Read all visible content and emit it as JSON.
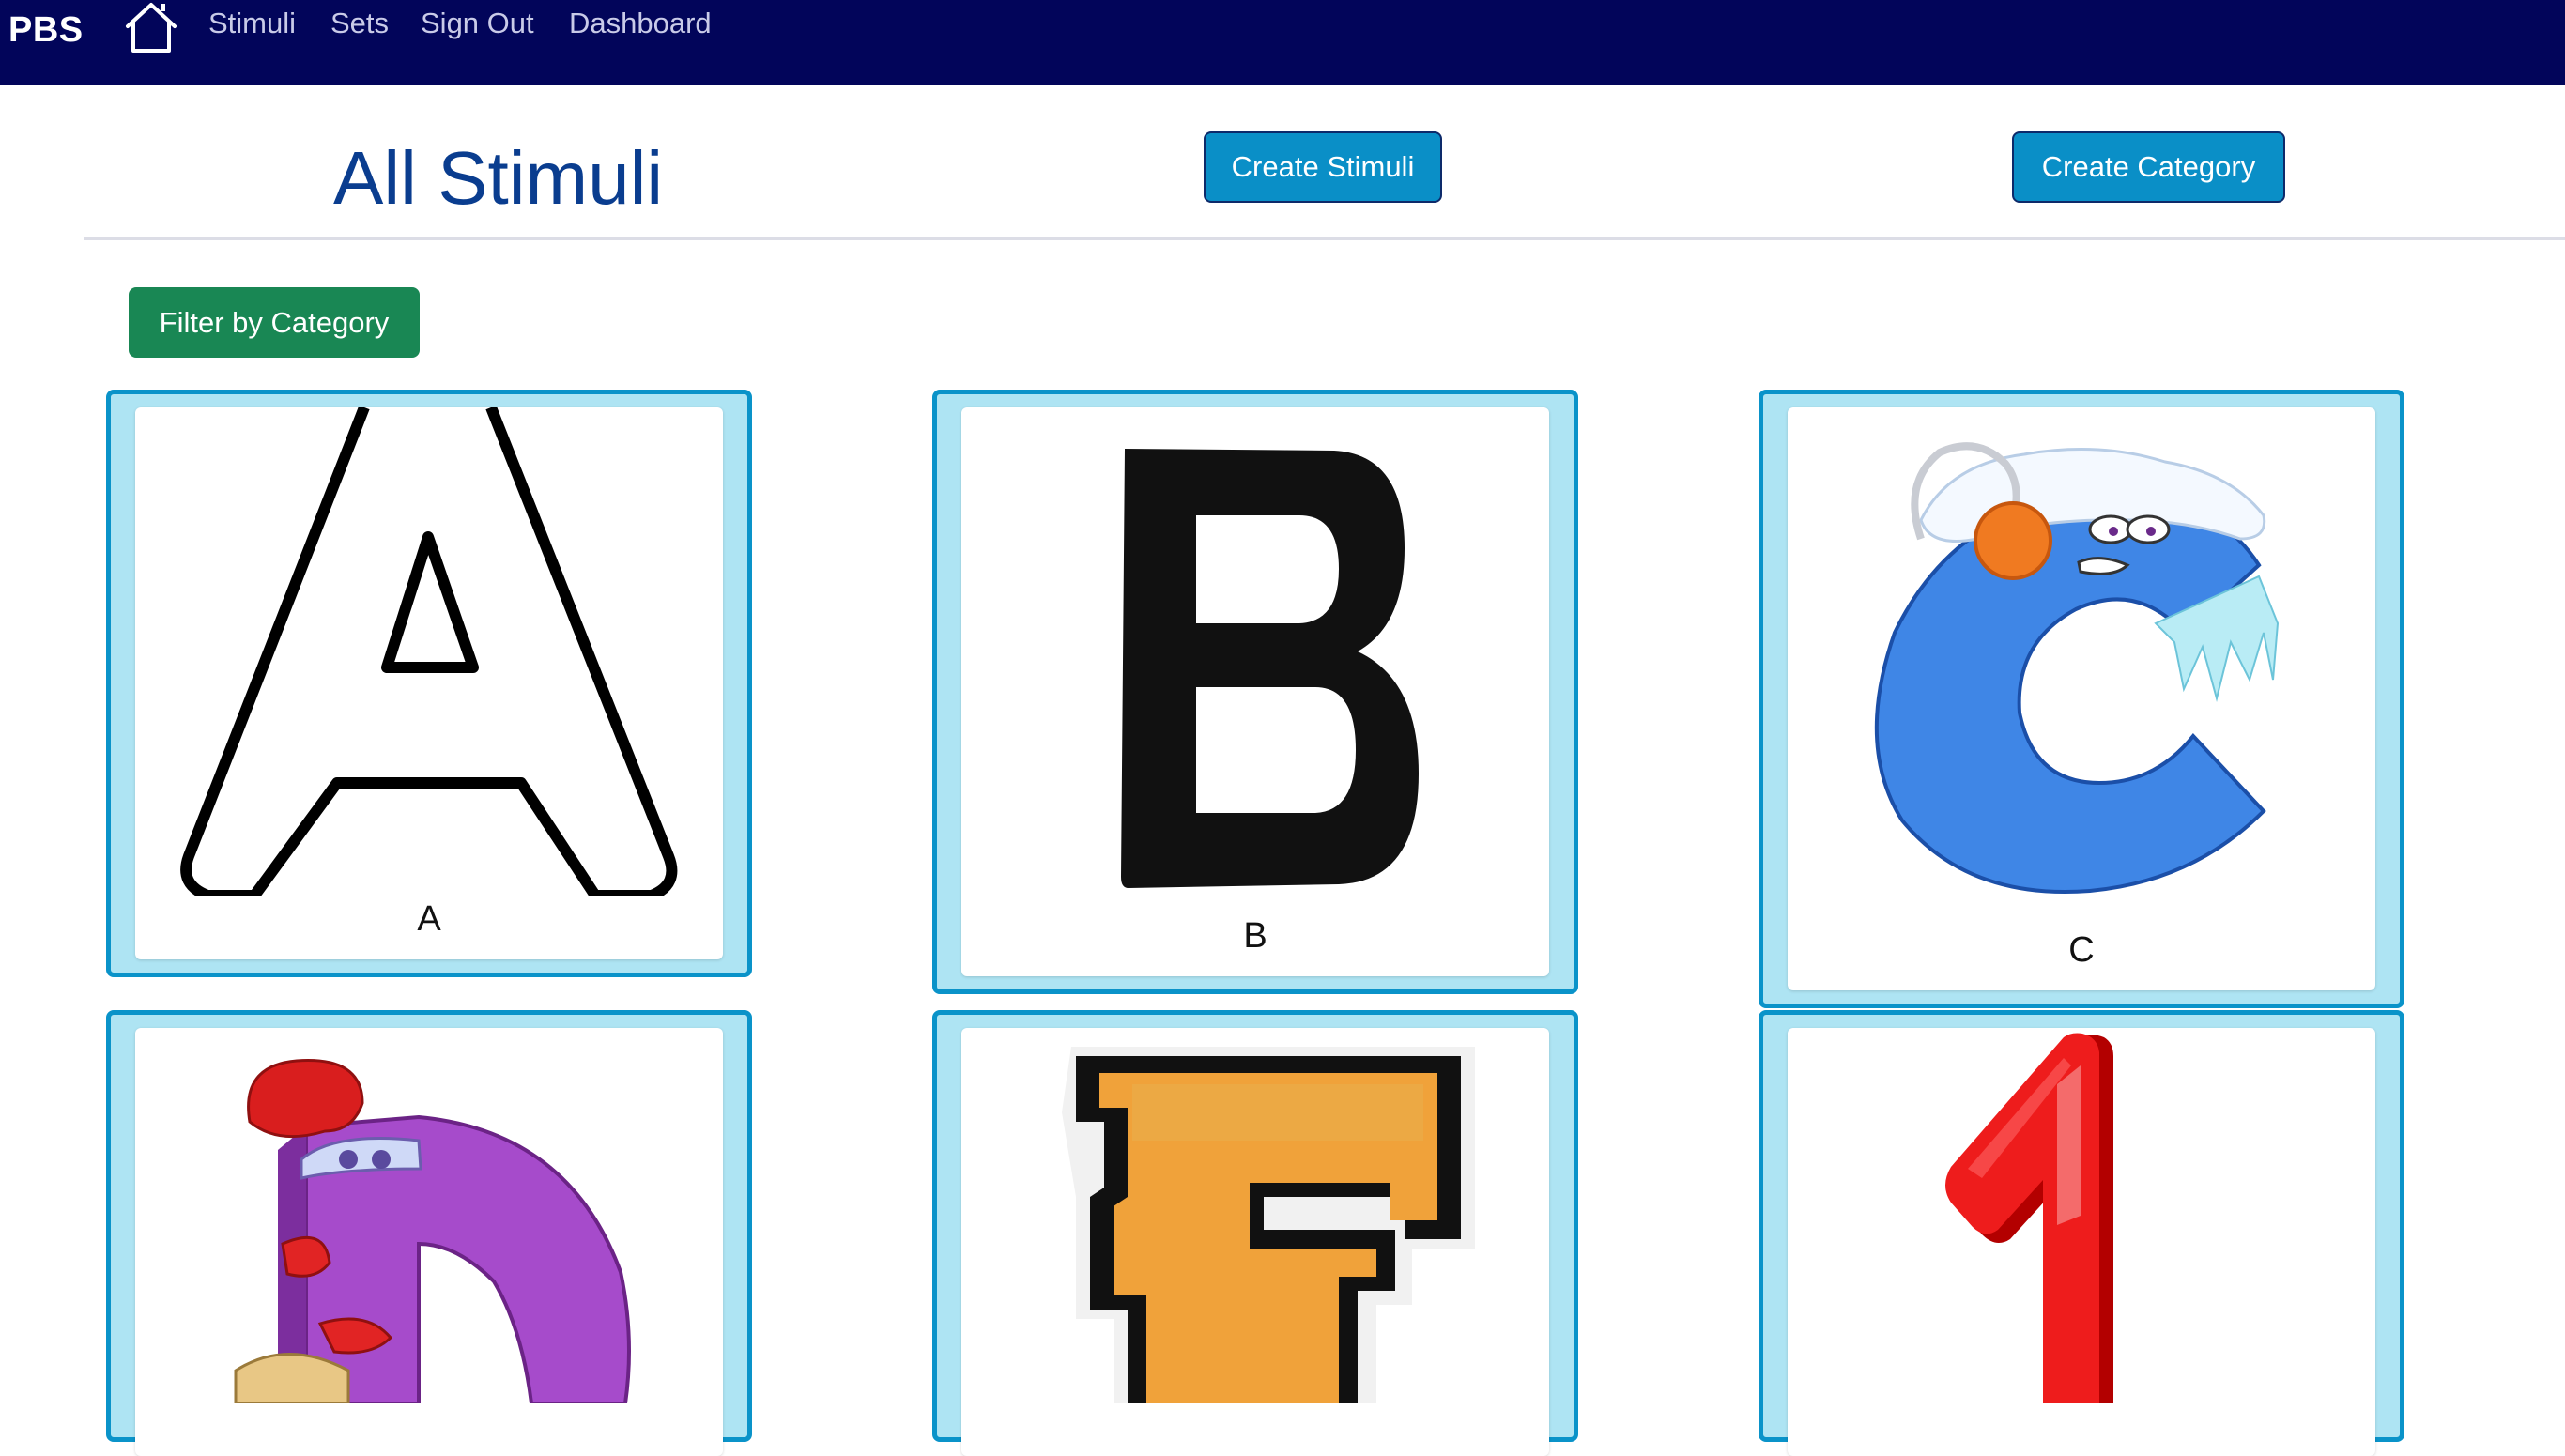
{
  "navbar": {
    "brand": "PBS",
    "links": [
      "Stimuli",
      "Sets",
      "Sign Out",
      "Dashboard"
    ]
  },
  "header": {
    "title": "All Stimuli",
    "create_stimuli_label": "Create Stimuli",
    "create_category_label": "Create Category"
  },
  "filter": {
    "label": "Filter by Category"
  },
  "stimuli": [
    {
      "label": "A",
      "image": "letter-a-outline"
    },
    {
      "label": "B",
      "image": "letter-b-black"
    },
    {
      "label": "C",
      "image": "letter-c-cartoon-frozen"
    },
    {
      "label": "",
      "image": "letter-d-cartoon-purple"
    },
    {
      "label": "",
      "image": "letter-f-varsity-orange"
    },
    {
      "label": "",
      "image": "number-1-red"
    }
  ],
  "colors": {
    "navbar": "#02055a",
    "title": "#0a3d8f",
    "primary_button": "#0a8fc7",
    "filter_button": "#198754",
    "card_border": "#0a93c9",
    "card_bg": "#aee4f3"
  }
}
